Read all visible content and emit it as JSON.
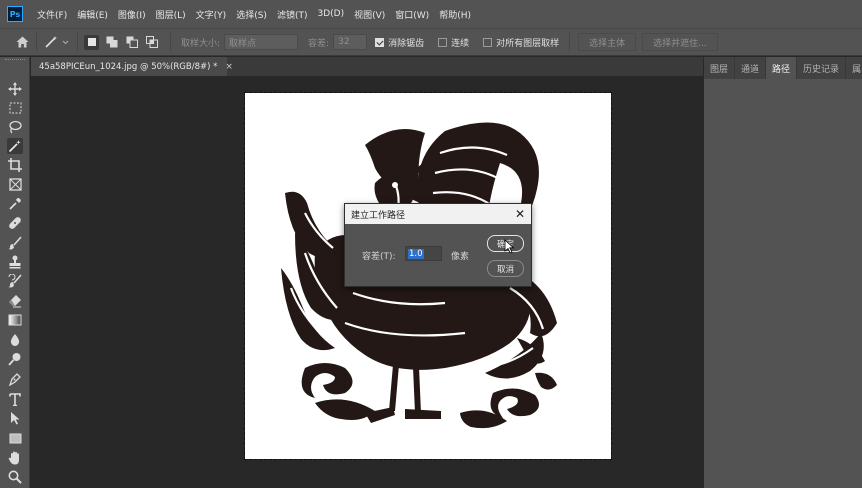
{
  "app": {
    "logo_text": "Ps"
  },
  "menu": [
    "文件(F)",
    "编辑(E)",
    "图像(I)",
    "图层(L)",
    "文字(Y)",
    "选择(S)",
    "滤镜(T)",
    "3D(D)",
    "视图(V)",
    "窗口(W)",
    "帮助(H)"
  ],
  "options": {
    "sample_size_label": "取样大小:",
    "sample_size_value": "取样点",
    "tolerance_label": "容差:",
    "tolerance_value": "32",
    "antialias_label": "消除锯齿",
    "antialias_checked": true,
    "contiguous_label": "连续",
    "contiguous_checked": false,
    "sample_all_label": "对所有图层取样",
    "sample_all_checked": false,
    "select_subject_label": "选择主体",
    "select_mask_label": "选择并遮住..."
  },
  "document": {
    "tab_title": "45a58PICEun_1024.jpg @ 50%(RGB/8#) *",
    "close_glyph": "×"
  },
  "panel": {
    "tabs": [
      "图层",
      "通道",
      "路径",
      "历史记录",
      "属"
    ],
    "active_tab": 2
  },
  "dialog": {
    "title": "建立工作路径",
    "close_glyph": "✕",
    "tolerance_label": "容差(T):",
    "tolerance_value": "1.0",
    "unit": "像素",
    "ok_label": "确定",
    "cancel_label": "取消"
  },
  "tools": [
    "move-tool-icon",
    "marquee-tool-icon",
    "lasso-tool-icon",
    "magic-wand-tool-icon",
    "crop-tool-icon",
    "frame-tool-icon",
    "eyedropper-tool-icon",
    "healing-brush-tool-icon",
    "brush-tool-icon",
    "clone-stamp-tool-icon",
    "history-brush-tool-icon",
    "eraser-tool-icon",
    "gradient-tool-icon",
    "blur-tool-icon",
    "dodge-tool-icon",
    "pen-tool-icon",
    "type-tool-icon",
    "path-selection-tool-icon",
    "rectangle-tool-icon",
    "hand-tool-icon",
    "zoom-tool-icon"
  ],
  "colors": {
    "accent": "#31a8ff",
    "selected_value": "#2f6fc9",
    "ui_bg": "#535353",
    "canvas_bg": "#282828"
  }
}
